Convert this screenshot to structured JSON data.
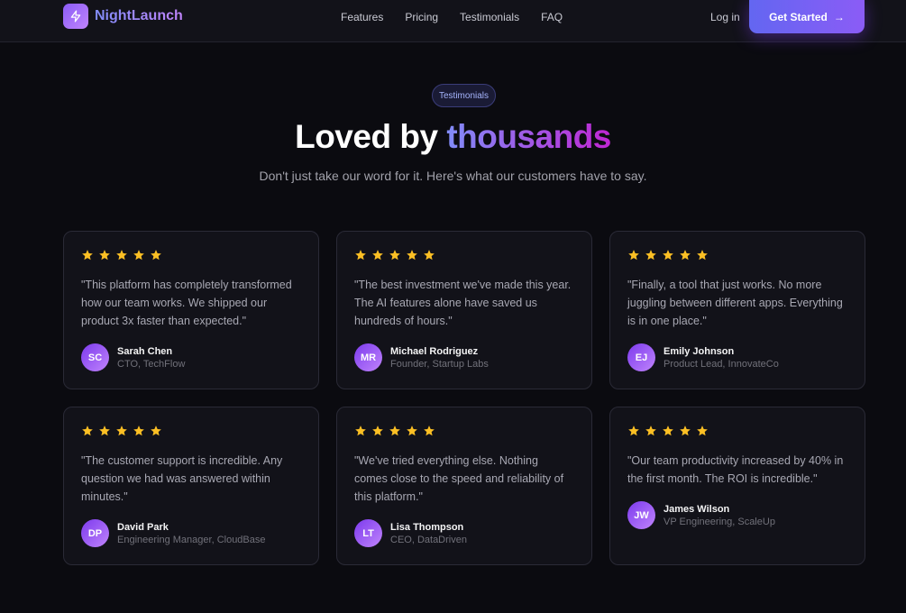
{
  "nav": {
    "brand": "NightLaunch",
    "links": [
      "Features",
      "Pricing",
      "Testimonials",
      "FAQ"
    ],
    "login": "Log in",
    "cta": "Get Started",
    "cta_arrow": "→"
  },
  "section": {
    "badge": "Testimonials",
    "headline_main": "Loved by ",
    "headline_accent": "thousands",
    "subtitle": "Don't just take our word for it. Here's what our customers have to say."
  },
  "colors": {
    "star": "#fbbf24",
    "accent": "#8b5cf6",
    "background": "#0b0b10"
  },
  "testimonials": [
    {
      "rating": 5,
      "quote": "\"This platform has completely transformed how our team works. We shipped our product 3x faster than expected.\"",
      "initials": "SC",
      "name": "Sarah Chen",
      "role": "CTO, TechFlow"
    },
    {
      "rating": 5,
      "quote": "\"The best investment we've made this year. The AI features alone have saved us hundreds of hours.\"",
      "initials": "MR",
      "name": "Michael Rodriguez",
      "role": "Founder, Startup Labs"
    },
    {
      "rating": 5,
      "quote": "\"Finally, a tool that just works. No more juggling between different apps. Everything is in one place.\"",
      "initials": "EJ",
      "name": "Emily Johnson",
      "role": "Product Lead, InnovateCo"
    },
    {
      "rating": 5,
      "quote": "\"The customer support is incredible. Any question we had was answered within minutes.\"",
      "initials": "DP",
      "name": "David Park",
      "role": "Engineering Manager, CloudBase"
    },
    {
      "rating": 5,
      "quote": "\"We've tried everything else. Nothing comes close to the speed and reliability of this platform.\"",
      "initials": "LT",
      "name": "Lisa Thompson",
      "role": "CEO, DataDriven"
    },
    {
      "rating": 5,
      "quote": "\"Our team productivity increased by 40% in the first month. The ROI is incredible.\"",
      "initials": "JW",
      "name": "James Wilson",
      "role": "VP Engineering, ScaleUp"
    }
  ]
}
